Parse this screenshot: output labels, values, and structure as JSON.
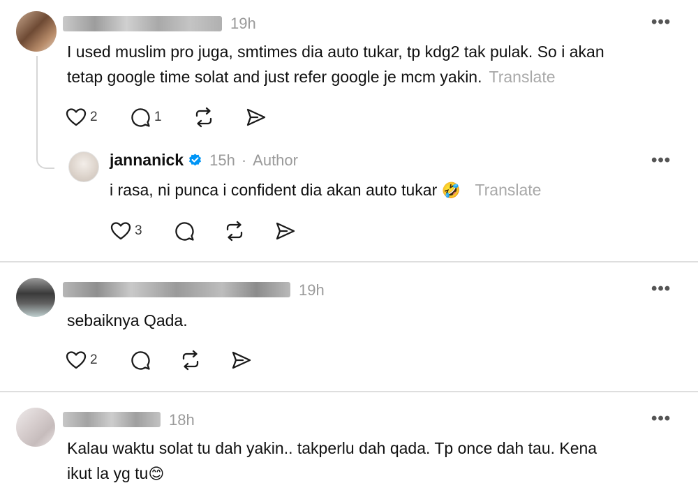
{
  "comment1": {
    "time": "19h",
    "text_line1": "I used muslim pro juga, smtimes dia auto tukar, tp kdg2 tak pulak. So i akan",
    "text_line2": "tetap google time solat and just refer google je mcm yakin.",
    "translate": "Translate",
    "likes": "2",
    "replies": "1",
    "more": "•••"
  },
  "reply1": {
    "username": "jannanick",
    "time": "15h",
    "separator": "·",
    "author_label": "Author",
    "text": "i rasa, ni punca i confident dia akan auto tukar",
    "emoji": "🤣",
    "translate": "Translate",
    "likes": "3",
    "more": "•••"
  },
  "comment2": {
    "time": "19h",
    "text": "sebaiknya Qada.",
    "likes": "2",
    "more": "•••"
  },
  "comment3": {
    "time": "18h",
    "text_line1": "Kalau waktu solat tu dah yakin.. takperlu dah qada. Tp once dah tau. Kena",
    "text_line2": "ikut la yg tu",
    "emoji": "😊",
    "more": "•••"
  },
  "icons": {
    "like": "heart-icon",
    "reply": "comment-bubble-icon",
    "repost": "repost-icon",
    "share": "send-icon",
    "verified": "verified-badge-icon"
  },
  "colors": {
    "text": "#101010",
    "muted": "#9a9a9a",
    "translate": "#a8a8a8",
    "verified": "#0095f6",
    "divider": "#dedede"
  }
}
